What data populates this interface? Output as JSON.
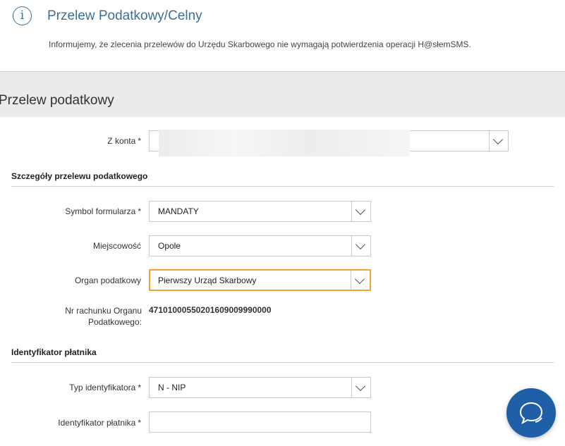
{
  "header": {
    "title": "Przelew Podatkowy/Celny",
    "notice": "Informujemy, że zlecenia przelewów do Urzędu Skarbowego nie wymagają potwierdzenia operacji H@słemSMS."
  },
  "form": {
    "title": "Przelew podatkowy",
    "from_account": {
      "label": "Z konta",
      "value": ""
    },
    "section_details": "Szczegóły przelewu podatkowego",
    "symbol": {
      "label": "Symbol formularza",
      "value": "MANDATY"
    },
    "city": {
      "label": "Miejscowość",
      "value": "Opole"
    },
    "tax_office": {
      "label": "Organ podatkowy",
      "value": "Pierwszy Urząd Skarbowy"
    },
    "account_number": {
      "label_line1": "Nr rachunku Organu",
      "label_line2": "Podatkowego:",
      "value": "47101000550201609009990000"
    },
    "section_payer": "Identyfikator płatnika",
    "id_type": {
      "label": "Typ identyfikatora",
      "value": "N - NIP"
    },
    "payer_id": {
      "label": "Identyfikator płatnika",
      "value": ""
    }
  },
  "required_mark": "*",
  "colors": {
    "accent": "#3d6f94",
    "focus": "#f2a33a",
    "chat": "#1f5fa8"
  },
  "icons": {
    "info": "info-icon",
    "chevron": "chevron-down-icon",
    "chat": "chat-icon"
  }
}
